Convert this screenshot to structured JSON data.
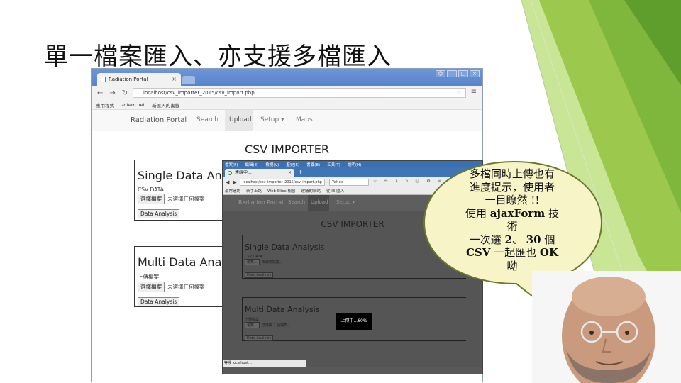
{
  "slide": {
    "title": "單一檔案匯入、亦支援多檔匯入"
  },
  "chrome": {
    "tab_title": "Radiation Portal",
    "tab_close": "×",
    "url": "localhost/csv_importer_2015/csv_import.php",
    "menu_icon": "≡",
    "bookmarks": [
      "應用程式",
      "zotero.net",
      "新匯入的書籤"
    ],
    "nav": {
      "brand": "Radiation Portal",
      "items": [
        "Search",
        "Upload",
        "Setup ▾",
        "Maps"
      ]
    },
    "page_title": "CSV IMPORTER",
    "single": {
      "heading": "Single Data Analysis",
      "label": "CSV DATA :",
      "choose_button": "選擇檔案",
      "file_status": "未選擇任何檔案",
      "analysis_button": "Data Analysis"
    },
    "multi": {
      "heading": "Multi Data Analysis",
      "label": "上傳檔案",
      "choose_button": "選擇檔案",
      "file_status": "未選擇任何檔案",
      "analysis_button": "Data Analysis"
    }
  },
  "firefox": {
    "menu": [
      "檔案(F)",
      "編輯(E)",
      "檢視(V)",
      "歷史(S)",
      "書籤(B)",
      "工具(T)",
      "說明(H)"
    ],
    "tab_title": "連線中...",
    "tab_close": "×",
    "new_tab": "+",
    "url": "localhost/csv_importer_2015/csv_import.php",
    "search_placeholder": "Yahoo",
    "toolbar": "☆ ☰ ⬇ ⌂ ☺ ⚙ ≡",
    "bookmarks": [
      "最常造訪",
      "新手上路",
      "Web Slice 櫥窗",
      "建議的網站",
      "從 IE 匯入"
    ],
    "nav": {
      "brand": "Radiation Portal",
      "items": [
        "Search",
        "Upload",
        "Setup ▾"
      ]
    },
    "page_title": "CSV IMPORTER",
    "single": {
      "heading": "Single Data Analysis",
      "label": "CSV DATA :",
      "choose_button": "瀏覽...",
      "file_status": "未選擇檔案。",
      "analysis_button": "Data Analysis"
    },
    "multi": {
      "heading": "Multi Data Analysis",
      "label": "上傳檔案",
      "choose_button": "瀏覽...",
      "file_status": "已選擇 7 個檔案。",
      "analysis_button": "Data Analysis"
    },
    "progress": "上傳中...60%",
    "status": "等候 localhost..."
  },
  "bubble": {
    "line1": "多檔同時上傳也有",
    "line2": "進度提示，使用者",
    "line3": "一目瞭然 !!",
    "line4_pre": "使用 ",
    "line4_bold": "ajaxForm",
    "line4_post": " 技",
    "line5": "術",
    "line6_pre": "一次選 ",
    "line6_bold1": "2",
    "line6_mid": "、 ",
    "line6_bold2": "30",
    "line6_post": " 個",
    "line7_bold1": "CSV",
    "line7_mid": " 一起匯也 ",
    "line7_bold2": "OK",
    "line8": "呦"
  },
  "colors": {
    "green_light": "#b5d86a",
    "green_dark": "#6da33a",
    "bubble_fill": "#f7f5c8",
    "bubble_stroke": "#6a7a2a"
  }
}
